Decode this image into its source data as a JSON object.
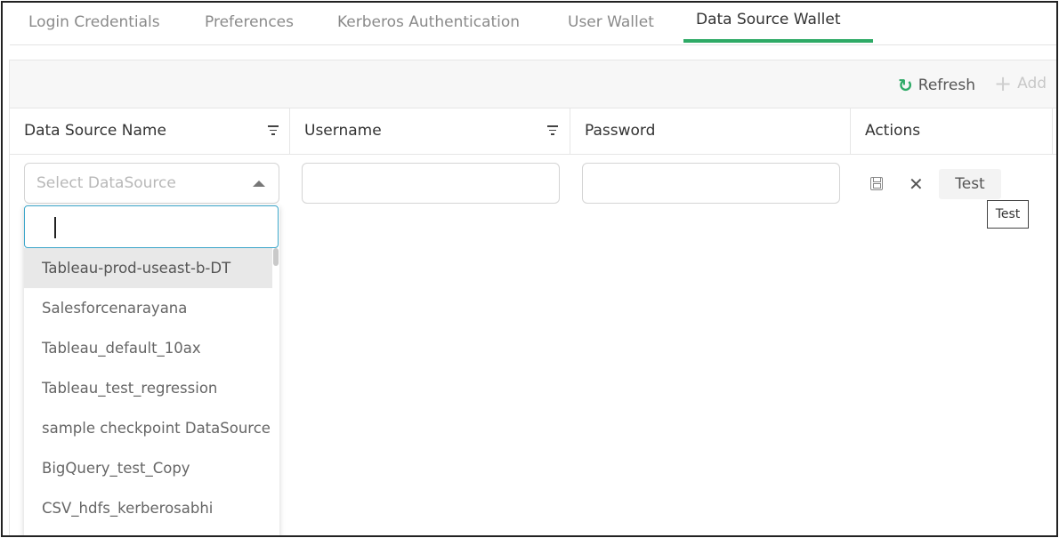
{
  "tabs": [
    {
      "label": "Login Credentials"
    },
    {
      "label": "Preferences"
    },
    {
      "label": "Kerberos Authentication"
    },
    {
      "label": "User Wallet"
    },
    {
      "label": "Data Source Wallet"
    }
  ],
  "active_tab": "Data Source Wallet",
  "toolbar": {
    "refresh_label": "Refresh",
    "refresh_icon": "refresh-icon",
    "add_label": "Add",
    "add_icon": "plus-icon"
  },
  "columns": [
    {
      "label": "Data Source Name",
      "filterable": true
    },
    {
      "label": "Username",
      "filterable": true
    },
    {
      "label": "Password",
      "filterable": false
    },
    {
      "label": "Actions",
      "filterable": false
    }
  ],
  "row_editor": {
    "datasource_placeholder": "Select DataSource",
    "username_value": "",
    "password_value": "",
    "test_label": "Test",
    "test_tooltip": "Test"
  },
  "dropdown": {
    "search_value": "",
    "options": [
      "Tableau-prod-useast-b-DT",
      "Salesforcenarayana",
      "Tableau_default_10ax",
      "Tableau_test_regression",
      "sample checkpoint DataSource",
      "BigQuery_test_Copy",
      "CSV_hdfs_kerberosabhi"
    ],
    "highlighted_option": "Tableau-prod-useast-b-DT"
  },
  "colors": {
    "accent": "#2eaa66",
    "focus_border": "#3ba5c9"
  }
}
